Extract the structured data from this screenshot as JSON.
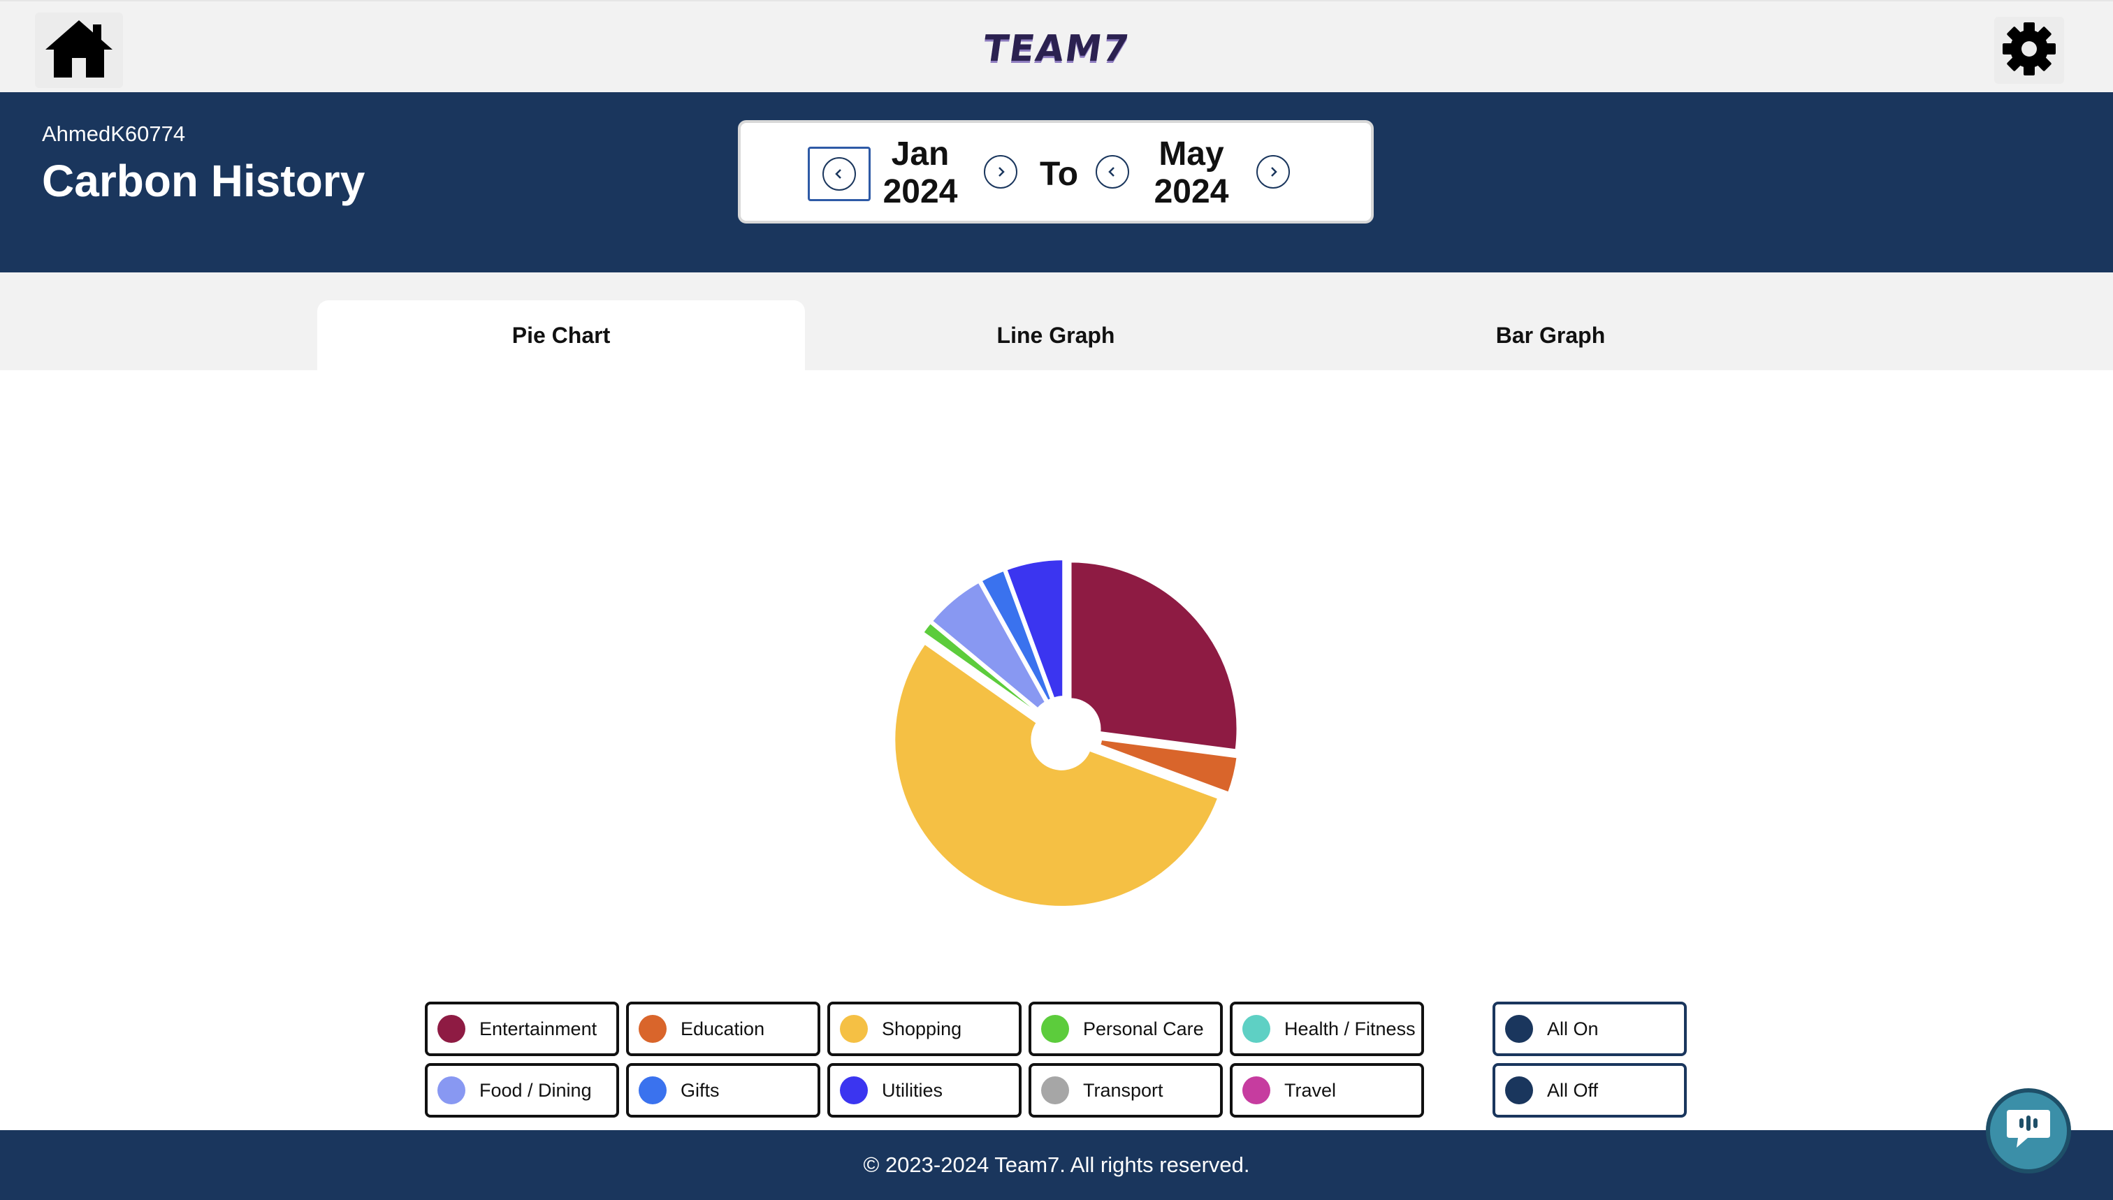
{
  "app": {
    "logo_text": "TEAM7"
  },
  "icons": {
    "home": "home-icon",
    "settings": "gear-icon",
    "chat": "chat-icon",
    "prev": "chevron-left-icon",
    "next": "chevron-right-icon"
  },
  "header": {
    "username": "AhmedK60774",
    "title": "Carbon History"
  },
  "date_range": {
    "start_month": "Jan",
    "start_year": "2024",
    "separator": "To",
    "end_month": "May",
    "end_year": "2024"
  },
  "tabs": [
    {
      "label": "Pie Chart",
      "active": true
    },
    {
      "label": "Line Graph",
      "active": false
    },
    {
      "label": "Bar Graph",
      "active": false
    }
  ],
  "chart_data": {
    "type": "pie",
    "donut_hole": true,
    "categories": [
      "Entertainment",
      "Education",
      "Shopping",
      "Personal Care",
      "Health / Fitness",
      "Food / Dining",
      "Gifts",
      "Utilities",
      "Transport",
      "Travel"
    ],
    "values": [
      26.5,
      3.5,
      53,
      1.2,
      0,
      5.8,
      2.4,
      5.5,
      0,
      0
    ],
    "colors": [
      "#8e1b43",
      "#d9652b",
      "#f5c044",
      "#5ccc3c",
      "#5ed0c4",
      "#8898f2",
      "#3a72ee",
      "#3b35f0",
      "#a6a6a6",
      "#c63c9f"
    ]
  },
  "legend": {
    "items": [
      {
        "label": "Entertainment",
        "color": "#8e1b43"
      },
      {
        "label": "Education",
        "color": "#d9652b"
      },
      {
        "label": "Shopping",
        "color": "#f5c044"
      },
      {
        "label": "Personal Care",
        "color": "#5ccc3c"
      },
      {
        "label": "Health / Fitness",
        "color": "#5ed0c4"
      },
      {
        "label": "Food / Dining",
        "color": "#8898f2"
      },
      {
        "label": "Gifts",
        "color": "#3a72ee"
      },
      {
        "label": "Utilities",
        "color": "#3b35f0"
      },
      {
        "label": "Transport",
        "color": "#a6a6a6"
      },
      {
        "label": "Travel",
        "color": "#c63c9f"
      }
    ],
    "all_on_label": "All On",
    "all_off_label": "All Off",
    "control_color": "#1a365d"
  },
  "footer": {
    "text": "© 2023-2024 Team7. All rights reserved."
  },
  "colors": {
    "navy": "#1a365d",
    "topbar_bg": "#f2f2f2"
  }
}
